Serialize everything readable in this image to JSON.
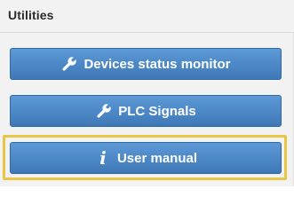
{
  "panel": {
    "title": "Utilities"
  },
  "buttons": [
    {
      "label": "Devices status monitor",
      "icon": "wrench-icon"
    },
    {
      "label": "PLC Signals",
      "icon": "wrench-icon"
    },
    {
      "label": "User manual",
      "icon": "info-icon",
      "icon_glyph": "i",
      "highlighted": true
    }
  ],
  "colors": {
    "button_top": "#5d9ad6",
    "button_bottom": "#3f78b6",
    "button_border": "#2f6aa6",
    "highlight_border": "#e8c544",
    "panel_bg": "#f2f2f2"
  }
}
